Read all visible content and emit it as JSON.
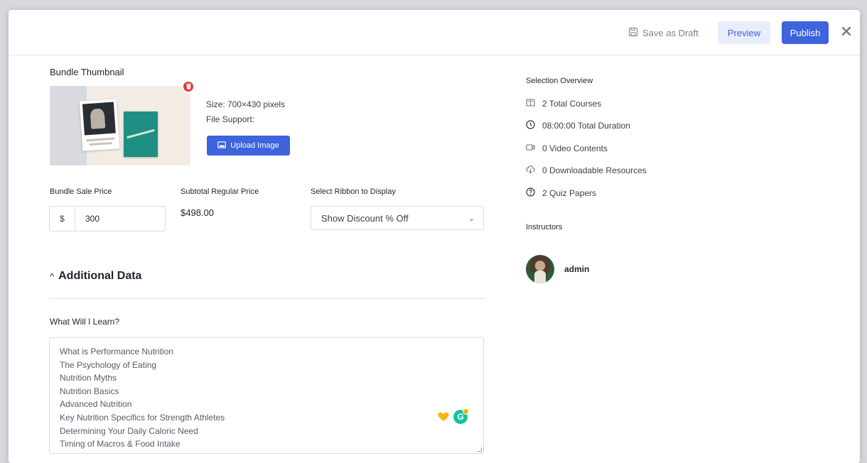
{
  "header": {
    "save_draft_label": "Save as Draft",
    "preview_label": "Preview",
    "publish_label": "Publish",
    "close_symbol": "✕"
  },
  "thumbnail": {
    "section_title": "Bundle Thumbnail",
    "size_text": "Size: 700×430 pixels",
    "file_support_text": "File Support:",
    "upload_label": "Upload Image",
    "delete_icon": "trash-icon"
  },
  "pricing": {
    "sale_price_label": "Bundle Sale Price",
    "currency_symbol": "$",
    "sale_price_value": "300",
    "subtotal_label": "Subtotal Regular Price",
    "subtotal_value": "$498.00",
    "ribbon_label": "Select Ribbon to Display",
    "ribbon_selected": "Show Discount % Off"
  },
  "additional": {
    "toggle_caret": "^",
    "title": "Additional Data",
    "learn_label": "What Will I Learn?",
    "learn_lines": [
      "What is Performance Nutrition",
      "The Psychology of Eating",
      "Nutrition Myths",
      "Nutrition Basics",
      "Advanced Nutrition",
      "Key Nutrition Specifics for Strength Athletes",
      "Determining Your Daily Caloric Need",
      "Timing of Macros & Food Intake"
    ]
  },
  "overview": {
    "title": "Selection Overview",
    "items": [
      {
        "icon": "book-icon",
        "text": "2 Total Courses"
      },
      {
        "icon": "clock-icon",
        "text": "08:00:00 Total Duration"
      },
      {
        "icon": "video-icon",
        "text": "0 Video Contents"
      },
      {
        "icon": "download-icon",
        "text": "0 Downloadable Resources"
      },
      {
        "icon": "quiz-icon",
        "text": "2 Quiz Papers"
      }
    ],
    "instructors_title": "Instructors",
    "instructor_name": "admin"
  },
  "colors": {
    "primary": "#3e63dd",
    "preview_bg": "#e9edfb",
    "danger": "#e53935"
  }
}
